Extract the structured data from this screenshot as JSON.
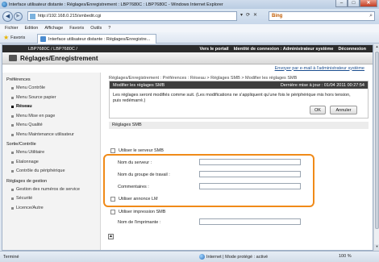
{
  "window": {
    "title": "Interface utilisateur distante : Réglages/Enregistrement : LBP7680C : LBP7680C - Windows Internet Explorer",
    "controls": [
      "–",
      "□",
      "✕"
    ]
  },
  "browser": {
    "back_glyph": "◀",
    "forward_glyph": "▶",
    "url": "http://192.168.0.215/smbedit.cgi",
    "url_icons": [
      "▾",
      "⟳",
      "✕"
    ],
    "search_engine": "Bing",
    "search_placeholder": "",
    "menu": [
      "Fichier",
      "Edition",
      "Affichage",
      "Favoris",
      "Outils",
      "?"
    ],
    "favorites_label": "Favoris",
    "tab_title": "Interface utilisateur distante : Réglages/Enregistre..."
  },
  "printer": {
    "model": "LBP7680C / LBP7680C /",
    "links": [
      "Vers le portail",
      "Identité de connexion : Administrateur système",
      "Déconnexion"
    ],
    "page_title": "Réglages/Enregistrement",
    "mail_link": "Envoyer par e-mail à l'administrateur système"
  },
  "sidebar": {
    "sections": [
      {
        "title": "Préférences",
        "items": [
          "Menu Contrôle",
          "Menu Source papier",
          "Réseau",
          "Menu Mise en page",
          "Menu Qualité",
          "Menu Maintenance utilisateur"
        ]
      },
      {
        "title": "Sortie/Contrôle",
        "items": [
          "Menu Utilitaire",
          "Etalonnage",
          "Contrôle du périphérique"
        ]
      },
      {
        "title": "Réglages de gestion",
        "items": [
          "Gestion des numéros de service",
          "Sécurité",
          "Licence/Autre"
        ]
      }
    ],
    "active_item": "Réseau"
  },
  "main": {
    "breadcrumb": "Réglages/Enregistrement : Préférences : Réseau > Réglages SMB > Modifier les réglages SMB",
    "panel_title": "Modifier les réglages SMB",
    "last_update": "Dernière mise à jour : 01/04 2011 00:27:54",
    "notice": "Les réglages seront modifiés comme suit. (Les modifications ne s'appliquent qu'une fois le périphérique mis hors tension, puis redémarré.)",
    "ok_label": "OK",
    "cancel_label": "Annuler",
    "section_title": "Réglages SMB",
    "use_smb_server": "Utiliser le serveur SMB",
    "server_name_label": "Nom du serveur :",
    "workgroup_label": "Nom du groupe de travail :",
    "comments_label": "Commentaires :",
    "use_lm_label": "Utiliser annonce LM",
    "use_smb_print": "Utiliser impression SMB",
    "printer_name_label": "Nom de l'imprimante :",
    "server_name_value": "",
    "workgroup_value": "",
    "comments_value": "",
    "printer_name_value": ""
  },
  "status": {
    "left": "Terminé",
    "zone": "Internet | Mode protégé : activé",
    "zoom": "100 %"
  }
}
